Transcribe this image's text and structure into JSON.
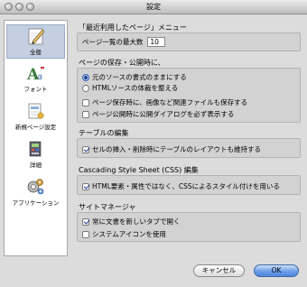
{
  "window": {
    "title": "設定"
  },
  "sidebar": {
    "items": [
      {
        "label": "全般",
        "icon": "pen-icon",
        "selected": true
      },
      {
        "label": "フォント",
        "icon": "font-icon",
        "selected": false
      },
      {
        "label": "新規ページ設定",
        "icon": "new-page-icon",
        "selected": false
      },
      {
        "label": "詳細",
        "icon": "advanced-icon",
        "selected": false
      },
      {
        "label": "アプリケーション",
        "icon": "application-icon",
        "selected": false
      }
    ]
  },
  "recent": {
    "title": "「最近利用したページ」メニュー",
    "max_label": "ページ一覧の最大数",
    "max_value": "10"
  },
  "save": {
    "title": "ページの保存・公開時に、",
    "radio_keep": "元のソースの書式のままにする",
    "radio_format": "HTMLソースの体裁を整える",
    "save_images": "ページ保存時に、画像など関連ファイルも保存する",
    "publish_dialog": "ページ公開時に公開ダイアログを必ず表示する"
  },
  "table": {
    "title": "テーブルの編集",
    "keep_layout": "セルの挿入・削除時にテーブルのレイアウトも維持する"
  },
  "css": {
    "title": "Cascading Style Sheet (CSS) 編集",
    "use_css": "HTML要素・属性ではなく、CSSによるスタイル付けを用いる"
  },
  "site": {
    "title": "サイトマネージャ",
    "new_tab": "常に文書を新しいタブで開く",
    "system_icons": "システムアイコンを使用"
  },
  "buttons": {
    "cancel": "キャンセル",
    "ok": "OK"
  },
  "colors": {
    "accent": "#4f86dc",
    "selection": "#c4cfe2"
  }
}
